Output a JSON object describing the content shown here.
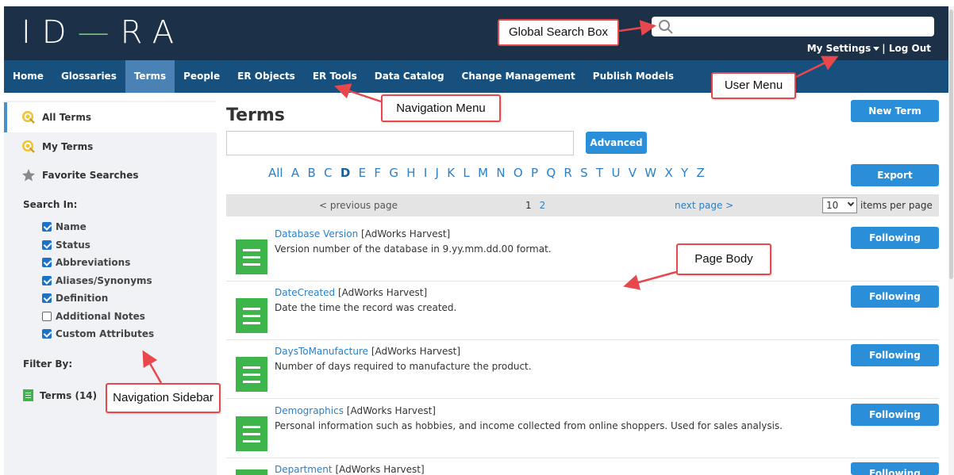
{
  "logo": {
    "part1": "ID",
    "part2": "—",
    "part3": "RA"
  },
  "user_menu": {
    "settings": "My Settings",
    "separator": "|",
    "logout": "Log Out"
  },
  "nav": [
    "Home",
    "Glossaries",
    "Terms",
    "People",
    "ER Objects",
    "ER Tools",
    "Data Catalog",
    "Change Management",
    "Publish Models"
  ],
  "nav_active": "Terms",
  "sidebar": {
    "all_terms": "All Terms",
    "my_terms": "My Terms",
    "favorite_searches": "Favorite Searches",
    "search_in_label": "Search In:",
    "search_in": [
      {
        "label": "Name",
        "checked": true
      },
      {
        "label": "Status",
        "checked": true
      },
      {
        "label": "Abbreviations",
        "checked": true
      },
      {
        "label": "Aliases/Synonyms",
        "checked": true
      },
      {
        "label": "Definition",
        "checked": true
      },
      {
        "label": "Additional Notes",
        "checked": false
      },
      {
        "label": "Custom Attributes",
        "checked": true
      }
    ],
    "filter_by_label": "Filter By:",
    "filter_terms": "Terms (14)"
  },
  "main": {
    "title": "Terms",
    "new_term": "New Term",
    "advanced": "Advanced",
    "export": "Export",
    "letters": [
      "All",
      "A",
      "B",
      "C",
      "D",
      "E",
      "F",
      "G",
      "H",
      "I",
      "J",
      "K",
      "L",
      "M",
      "N",
      "O",
      "P",
      "Q",
      "R",
      "S",
      "T",
      "U",
      "V",
      "W",
      "X",
      "Y",
      "Z"
    ],
    "active_letter": "D",
    "pager": {
      "prev": "< previous page",
      "page1": "1",
      "page2": "2",
      "next": "next page >",
      "per_page": "10",
      "per_page_label": "items per page"
    },
    "follow_label": "Following",
    "rows": [
      {
        "name": "Database Version",
        "source": "[AdWorks Harvest]",
        "desc": "Version number of the database in 9.yy.mm.dd.00 format."
      },
      {
        "name": "DateCreated",
        "source": "[AdWorks Harvest]",
        "desc": "Date the time the record was created."
      },
      {
        "name": "DaysToManufacture",
        "source": "[AdWorks Harvest]",
        "desc": "Number of days required to manufacture the product."
      },
      {
        "name": "Demographics",
        "source": "[AdWorks Harvest]",
        "desc": "Personal information such as hobbies, and income collected from online shoppers. Used for sales analysis."
      },
      {
        "name": "Department",
        "source": "[AdWorks Harvest]",
        "desc": ""
      }
    ]
  },
  "callouts": {
    "global_search": "Global Search Box",
    "user_menu": "User Menu",
    "navigation_menu": "Navigation Menu",
    "page_body": "Page Body",
    "navigation_sidebar": "Navigation Sidebar"
  },
  "colors": {
    "header": "#1c3148",
    "nav": "#17507d",
    "nav_active": "#4a82b5",
    "accent": "#2a8fd8",
    "term_green": "#3db54a",
    "callout_border": "#e8474b"
  }
}
